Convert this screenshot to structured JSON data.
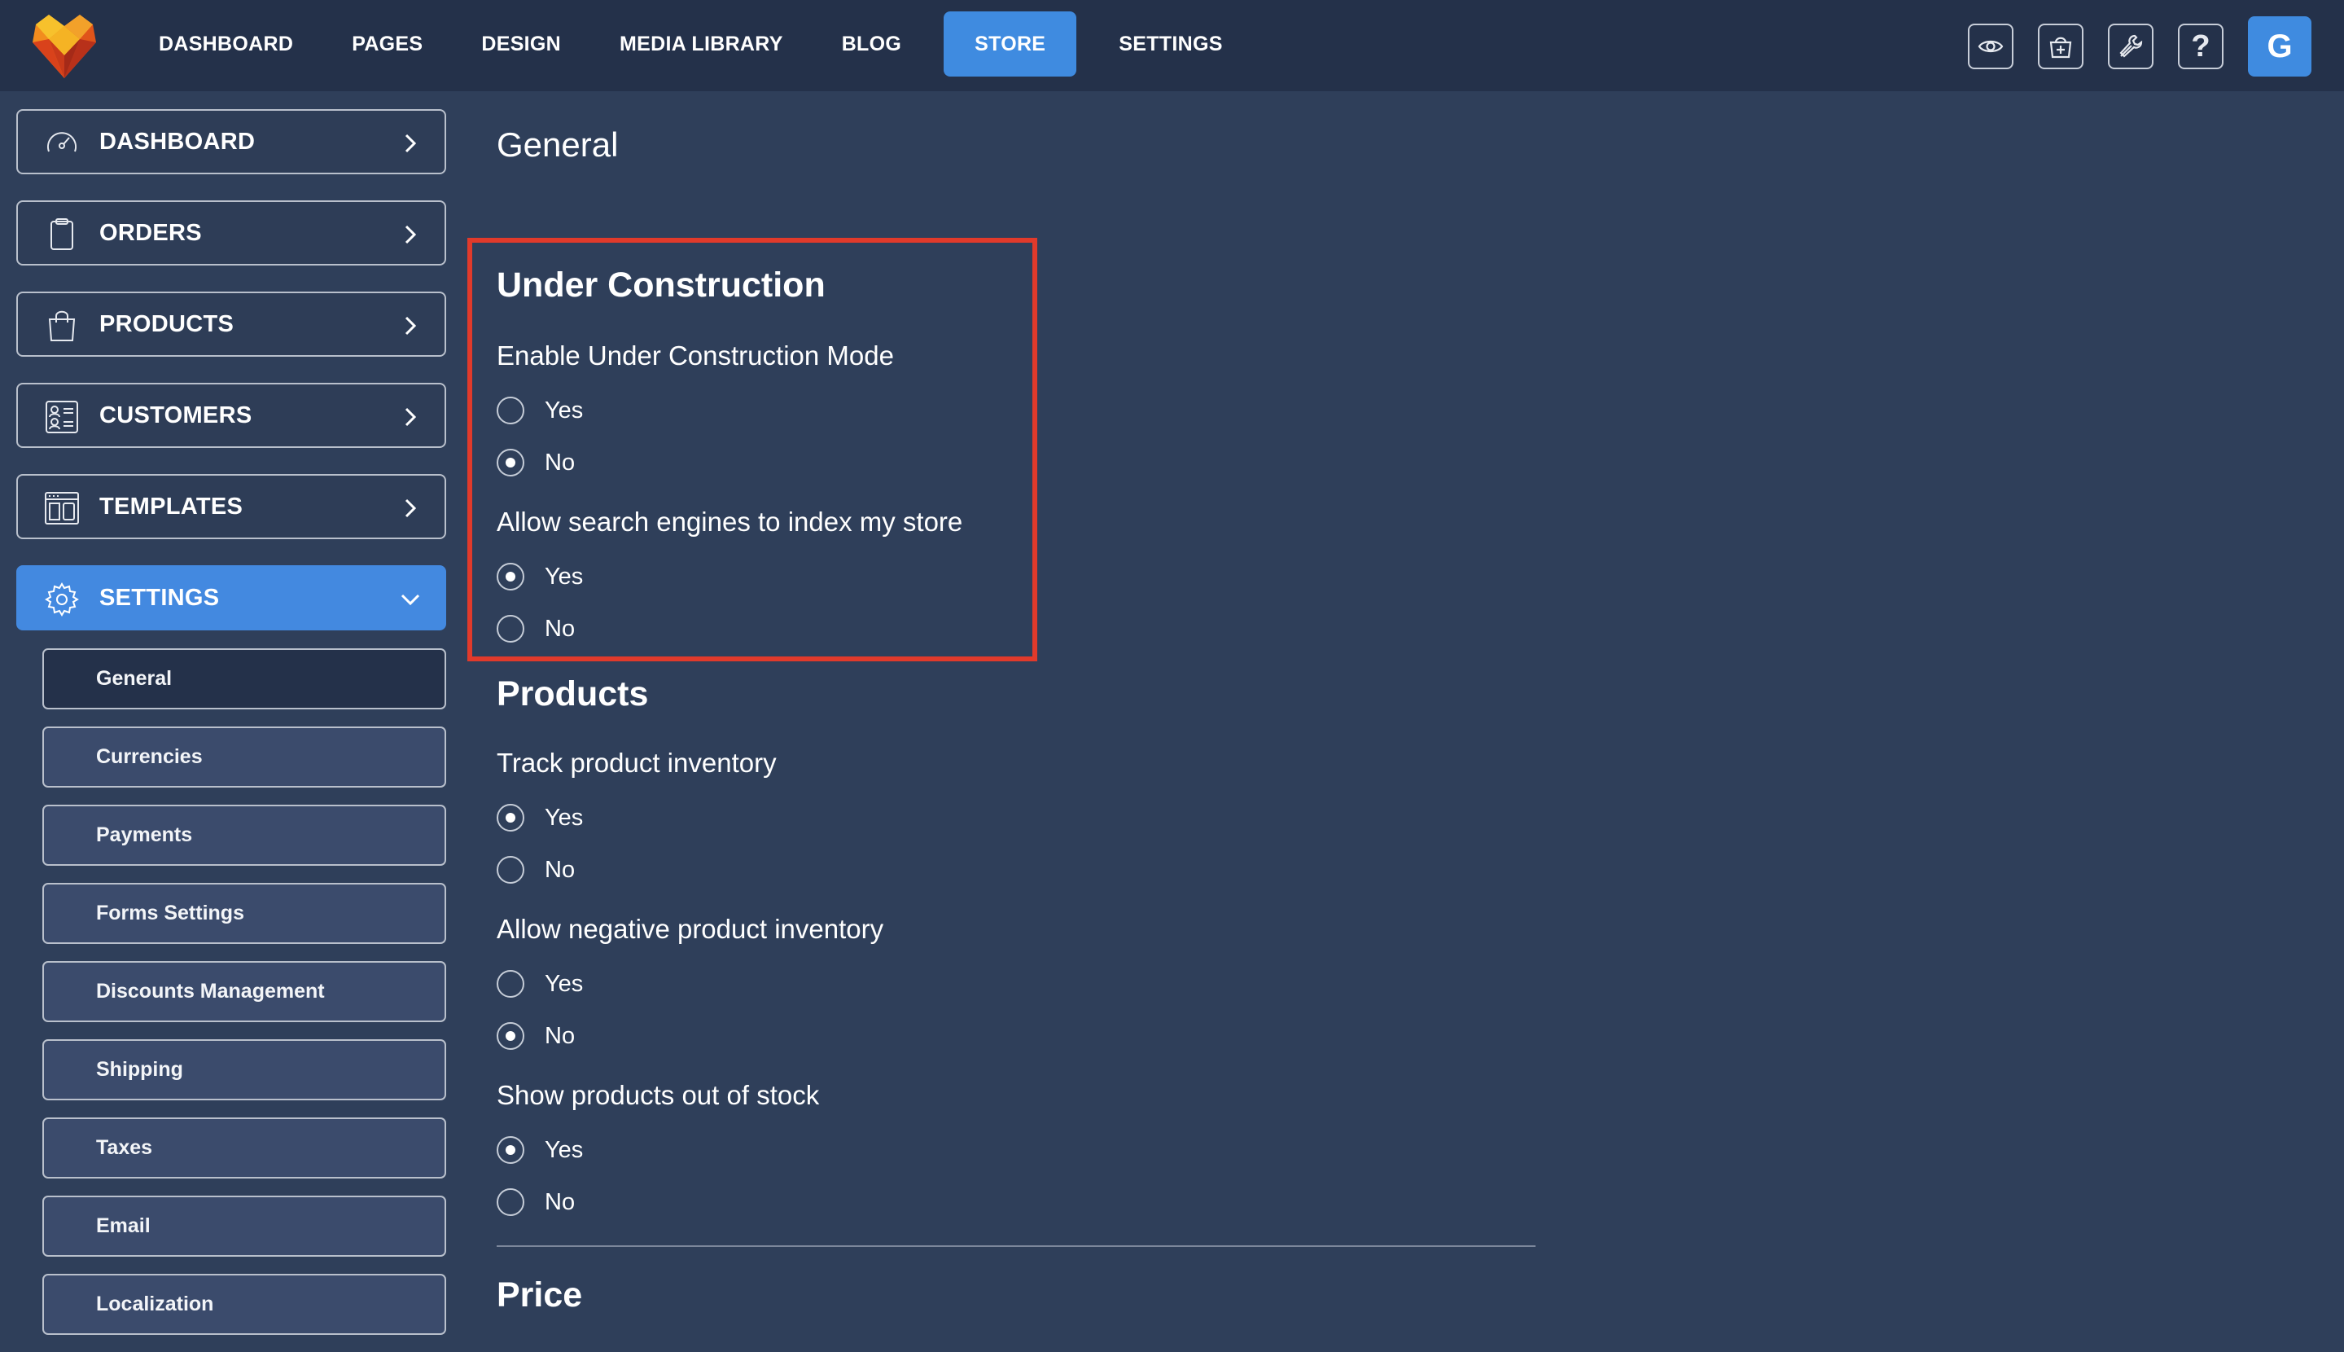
{
  "topnav": {
    "items": [
      {
        "label": "DASHBOARD",
        "active": false
      },
      {
        "label": "PAGES",
        "active": false
      },
      {
        "label": "DESIGN",
        "active": false
      },
      {
        "label": "MEDIA LIBRARY",
        "active": false
      },
      {
        "label": "BLOG",
        "active": false
      },
      {
        "label": "STORE",
        "active": true
      },
      {
        "label": "SETTINGS",
        "active": false
      }
    ],
    "icons": [
      "eye-icon",
      "store-add-icon",
      "wrench-icon",
      "help-icon"
    ],
    "help_glyph": "?",
    "avatar_letter": "G",
    "accent": "#3f8be0"
  },
  "sidebar": {
    "items": [
      {
        "label": "DASHBOARD",
        "icon": "gauge-icon"
      },
      {
        "label": "ORDERS",
        "icon": "clipboard-icon"
      },
      {
        "label": "PRODUCTS",
        "icon": "shopping-bag-icon"
      },
      {
        "label": "CUSTOMERS",
        "icon": "contacts-icon"
      },
      {
        "label": "TEMPLATES",
        "icon": "template-icon"
      },
      {
        "label": "SETTINGS",
        "icon": "gear-icon",
        "active": true
      }
    ],
    "settings_sub": [
      {
        "label": "General",
        "active": true
      },
      {
        "label": "Currencies"
      },
      {
        "label": "Payments"
      },
      {
        "label": "Forms Settings"
      },
      {
        "label": "Discounts Management"
      },
      {
        "label": "Shipping"
      },
      {
        "label": "Taxes"
      },
      {
        "label": "Email"
      },
      {
        "label": "Localization"
      }
    ]
  },
  "main": {
    "page_title": "General",
    "under_construction": {
      "title": "Under Construction",
      "q1": {
        "label": "Enable Under Construction Mode",
        "yes": "Yes",
        "no": "No",
        "selected": "No"
      },
      "q2": {
        "label": "Allow search engines to index my store",
        "yes": "Yes",
        "no": "No",
        "selected": "Yes"
      }
    },
    "products": {
      "title": "Products",
      "q1": {
        "label": "Track product inventory",
        "yes": "Yes",
        "no": "No",
        "selected": "Yes"
      },
      "q2": {
        "label": "Allow negative product inventory",
        "yes": "Yes",
        "no": "No",
        "selected": "No"
      },
      "q3": {
        "label": "Show products out of stock",
        "yes": "Yes",
        "no": "No",
        "selected": "Yes"
      }
    },
    "price": {
      "title": "Price"
    }
  }
}
